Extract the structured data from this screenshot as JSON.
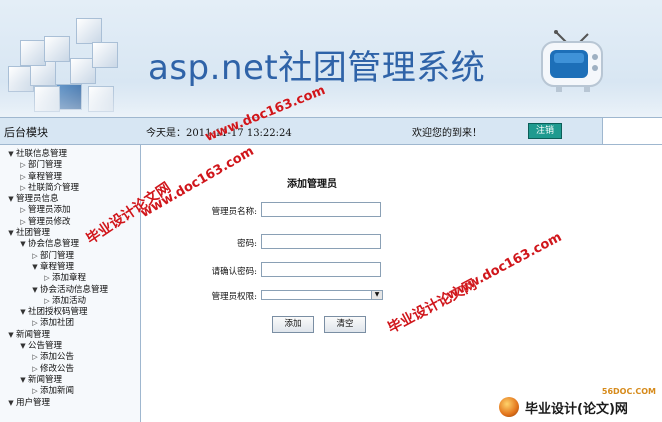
{
  "header": {
    "title": "asp.net社团管理系统"
  },
  "topbar": {
    "module": "后台模块",
    "today": "今天是：2011-11-17 13:22:24",
    "welcome": "欢迎您的到来！",
    "logout": "注销"
  },
  "sidebar": {
    "items": [
      {
        "label": "社联信息管理",
        "level": 0,
        "open": true
      },
      {
        "label": "部门管理",
        "level": 1
      },
      {
        "label": "章程管理",
        "level": 1
      },
      {
        "label": "社联简介管理",
        "level": 1
      },
      {
        "label": "管理员信息",
        "level": 0,
        "open": true
      },
      {
        "label": "管理员添加",
        "level": 1
      },
      {
        "label": "管理员修改",
        "level": 1
      },
      {
        "label": "社团管理",
        "level": 0,
        "open": true
      },
      {
        "label": "协会信息管理",
        "level": 1,
        "open": true
      },
      {
        "label": "部门管理",
        "level": 2
      },
      {
        "label": "章程管理",
        "level": 2,
        "open": true
      },
      {
        "label": "添加章程",
        "level": 3
      },
      {
        "label": "协会活动信息管理",
        "level": 2,
        "open": true
      },
      {
        "label": "添加活动",
        "level": 3
      },
      {
        "label": "社团授权码管理",
        "level": 1,
        "open": true
      },
      {
        "label": "添加社团",
        "level": 2
      },
      {
        "label": "新闻管理",
        "level": 0,
        "open": true
      },
      {
        "label": "公告管理",
        "level": 1,
        "open": true
      },
      {
        "label": "添加公告",
        "level": 2
      },
      {
        "label": "修改公告",
        "level": 2
      },
      {
        "label": "新闻管理",
        "level": 1,
        "open": true
      },
      {
        "label": "添加新闻",
        "level": 2
      },
      {
        "label": "用户管理",
        "level": 0,
        "open": true
      }
    ]
  },
  "form": {
    "title": "添加管理员",
    "name_label": "管理员名称:",
    "name_value": "",
    "password_label": "密码:",
    "password_value": "",
    "confirm_label": "请确认密码:",
    "confirm_value": "",
    "role_label": "管理员权限:",
    "role_value": "",
    "add_button": "添加",
    "clear_button": "清空"
  },
  "watermarks": {
    "url": "www.doc163.com",
    "text": "毕业设计论文网"
  },
  "logo": {
    "site": "56DOC.COM",
    "brand": "毕业设计(论文)网"
  },
  "colors": {
    "title_blue": "#2f63a8",
    "logout_teal": "#1f9a8f",
    "watermark_red": "#d0161b"
  }
}
